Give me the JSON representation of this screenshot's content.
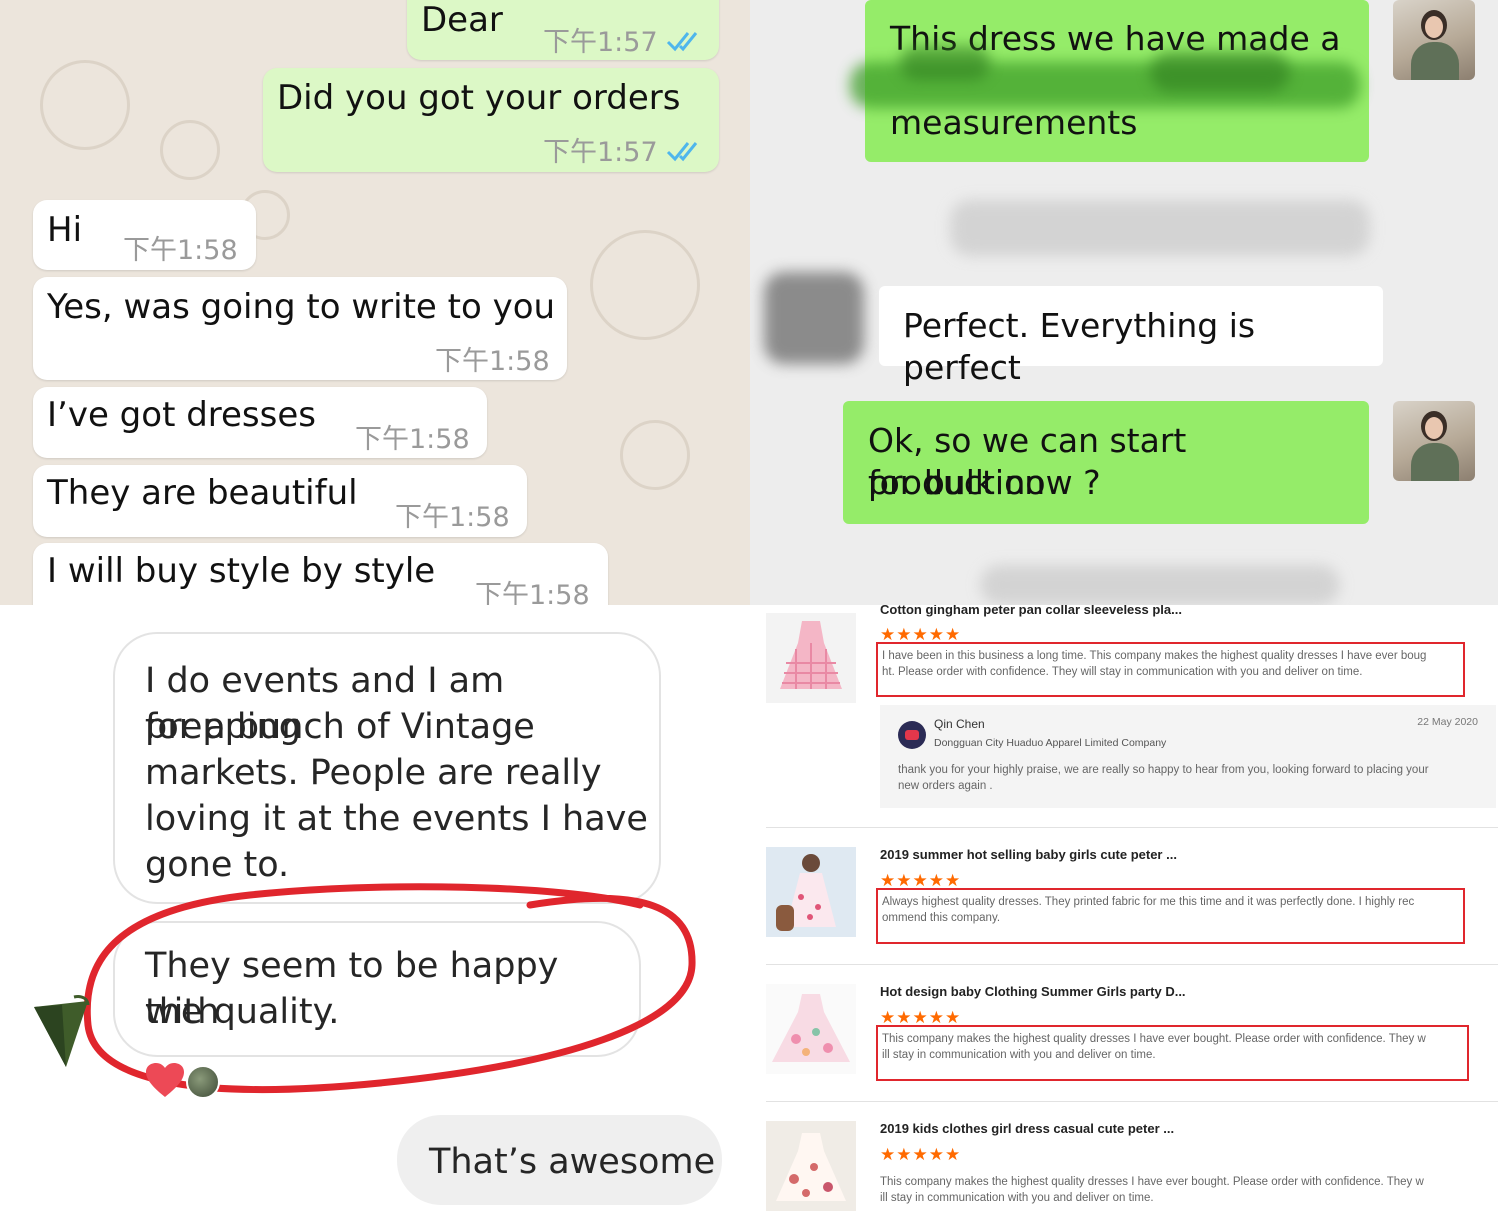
{
  "whatsapp": {
    "messages": [
      {
        "text": "Dear",
        "time": "下午1:57",
        "dir": "out"
      },
      {
        "text": "Did you got your orders",
        "time": "下午1:57",
        "dir": "out"
      },
      {
        "text": "Hi",
        "time": "下午1:58",
        "dir": "in"
      },
      {
        "text": "Yes, was going to write to you",
        "time": "下午1:58",
        "dir": "in"
      },
      {
        "text": "I’ve got dresses",
        "time": "下午1:58",
        "dir": "in"
      },
      {
        "text": "They are beautiful",
        "time": "下午1:58",
        "dir": "in"
      },
      {
        "text": "I will buy style by style",
        "time": "下午1:58",
        "dir": "in"
      }
    ],
    "colors": {
      "out": "#dcf8c6",
      "in": "#ffffff",
      "ticks": "#4fb6ec"
    }
  },
  "wechat": {
    "messages": [
      {
        "line1": "This dress we have made a",
        "line2": "measurements",
        "dir": "out"
      },
      {
        "text": "Perfect. Everything is perfect",
        "dir": "in"
      },
      {
        "line1": "Ok, so we can start production",
        "line2": "for bulk now ?",
        "dir": "out"
      }
    ],
    "colors": {
      "bubble_out": "#95ec69",
      "bubble_in": "#ffffff",
      "background": "#ededed"
    }
  },
  "instagram": {
    "messages": [
      {
        "lines": [
          "I do events and I am prepping",
          "for a bunch of Vintage",
          "markets. People are really",
          "loving it at the events I have",
          "gone to."
        ],
        "dir": "in"
      },
      {
        "lines": [
          "They seem to be happy with",
          "the quality."
        ],
        "dir": "in",
        "highlighted": true
      },
      {
        "text": "That’s awesome",
        "dir": "out"
      }
    ],
    "reactions": [
      "heart-icon",
      "avatar"
    ],
    "colors": {
      "highlight_ring": "#e0262d",
      "heart": "#ed4956"
    }
  },
  "reviews": {
    "items": [
      {
        "title": "Cotton gingham peter pan collar sleeveless pla...",
        "stars": "★★★★★",
        "line1": "I have been in this business a long time.  This company makes the highest quality dresses I have ever boug",
        "line2": "ht. Please order with confidence.  They will stay in communication with you and deliver on time.",
        "highlighted": true,
        "reply": {
          "name": "Qin Chen",
          "date": "22 May 2020",
          "company": "Dongguan City Huaduo Apparel Limited Company",
          "line1": "thank you for your highly praise, we are really so happy to hear from you, looking forward to placing your",
          "line2": "new orders again ."
        }
      },
      {
        "title": "2019 summer hot selling baby girls cute peter ...",
        "stars": "★★★★★",
        "line1": "Always highest quality dresses.  They printed fabric for me this time and it was perfectly done.  I highly rec",
        "line2": "ommend this company.",
        "highlighted": true
      },
      {
        "title": "Hot design baby Clothing Summer Girls party D...",
        "stars": "★★★★★",
        "line1": "This company makes the highest quality dresses I have ever bought. Please order with confidence.  They w",
        "line2": "ill stay in communication with you and deliver on time.",
        "highlighted": true
      },
      {
        "title": "2019 kids clothes girl dress casual cute peter ...",
        "stars": "★★★★★",
        "line1": "This company makes the highest quality dresses I have ever bought. Please order with confidence.  They w",
        "line2": "ill stay in communication with you and deliver on time.",
        "highlighted": false
      }
    ],
    "colors": {
      "stars": "#ff6a00",
      "highlight_box": "#e0262d"
    }
  }
}
